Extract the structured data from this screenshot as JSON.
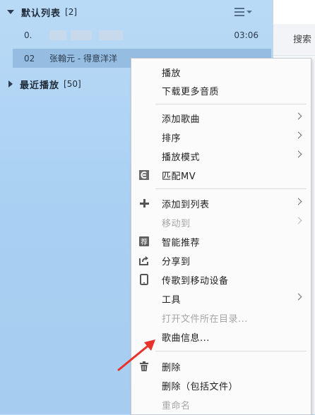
{
  "playlist": {
    "default_group": {
      "title": "默认列表",
      "count": "[2]"
    },
    "songs": [
      {
        "num": "0.",
        "title": "",
        "time": "03:06"
      },
      {
        "num": "02",
        "title": "张翰元 - 得意洋洋",
        "time": ""
      }
    ],
    "recent_group": {
      "title": "最近播放",
      "count": "[50]"
    }
  },
  "right_panel": {
    "search_tab": "搜索"
  },
  "context_menu": {
    "play": "播放",
    "download_quality": "下载更多音质",
    "add_song": "添加歌曲",
    "sort": "排序",
    "play_mode": "播放模式",
    "match_mv": "匹配MV",
    "add_to_list": "添加到列表",
    "move_to": "移动到",
    "smart_recommend": "智能推荐",
    "share_to": "分享到",
    "transfer_device": "传歌到移动设备",
    "tools": "工具",
    "open_folder": "打开文件所在目录...",
    "song_info": "歌曲信息...",
    "delete": "删除",
    "delete_with_file": "删除（包括文件）",
    "rename": "重命名"
  },
  "colors": {
    "accent_arrow": "#e8322b",
    "selected_row": "#95bde2",
    "background": "#b9daf6"
  }
}
